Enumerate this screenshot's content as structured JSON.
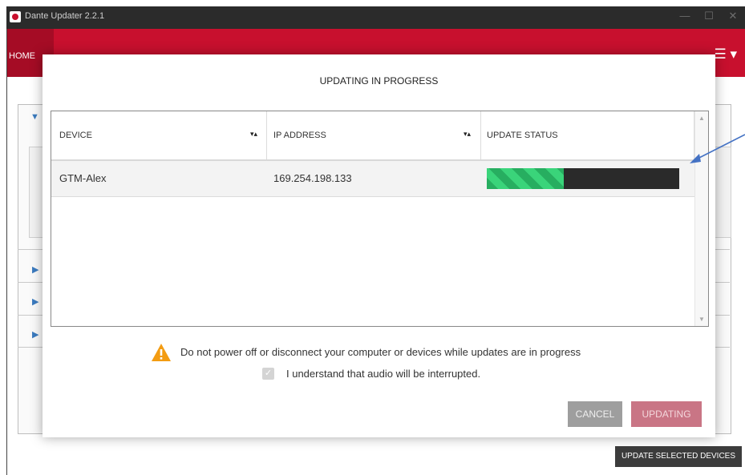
{
  "window": {
    "title": "Dante Updater 2.2.1",
    "min_glyph": "—",
    "max_glyph": "☐",
    "close_glyph": "✕"
  },
  "nav": {
    "home_label": "HOME"
  },
  "background": {
    "update_selected_label": "UPDATE SELECTED DEVICES"
  },
  "modal": {
    "title": "UPDATING IN PROGRESS",
    "columns": {
      "device": "DEVICE",
      "ip": "IP ADDRESS",
      "status": "UPDATE STATUS"
    },
    "rows": [
      {
        "device": "GTM-Alex",
        "ip": "169.254.198.133",
        "progress": 0.4
      }
    ],
    "warning_text": "Do not power off or disconnect your computer or devices while updates are in progress",
    "checkbox_label": "I understand that audio will be interrupted.",
    "checkbox_checked": true,
    "cancel_label": "CANCEL",
    "updating_label": "UPDATING"
  },
  "colors": {
    "brand_red": "#c8102e",
    "progress_green": "#27ae60",
    "annotation_blue": "#4472c4",
    "warning_orange": "#f39c12"
  },
  "icons": {
    "sort": "sort-icon",
    "warning": "warning-icon",
    "menu": "hamburger-icon"
  }
}
